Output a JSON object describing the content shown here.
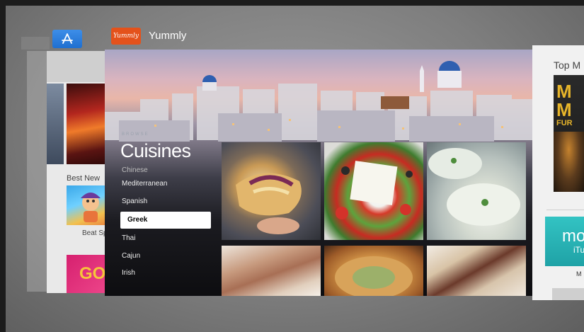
{
  "app_switcher": {
    "left_app": {
      "icon": "app-store-icon",
      "section_title": "Best New",
      "game_title": "Beat Sp",
      "promo_text": "GO"
    },
    "focused_app": {
      "name": "Yummly",
      "icon_text": "Yummly",
      "browse_label": "BROWSE",
      "heading": "Cuisines",
      "cuisines": [
        "Chinese",
        "Mediterranean",
        "Spanish",
        "Greek",
        "Thai",
        "Cajun",
        "Irish"
      ],
      "selected_cuisine": "Greek",
      "tiles": [
        "gyro-wrap",
        "greek-salad",
        "tzatziki-dip",
        "stuffed-roll",
        "spanakopita",
        "feta-bites"
      ]
    },
    "right_app": {
      "section_title": "Top M",
      "poster_title": "M\nM",
      "poster_sub": "FUR",
      "promo_text": "mo",
      "promo_sub": "iTu",
      "caption": "M"
    }
  },
  "colors": {
    "yummly_orange": "#e4521b",
    "app_store_blue": "#1f6fd0",
    "selection_white": "#ffffff",
    "teal_promo": "#1fa2a6"
  }
}
